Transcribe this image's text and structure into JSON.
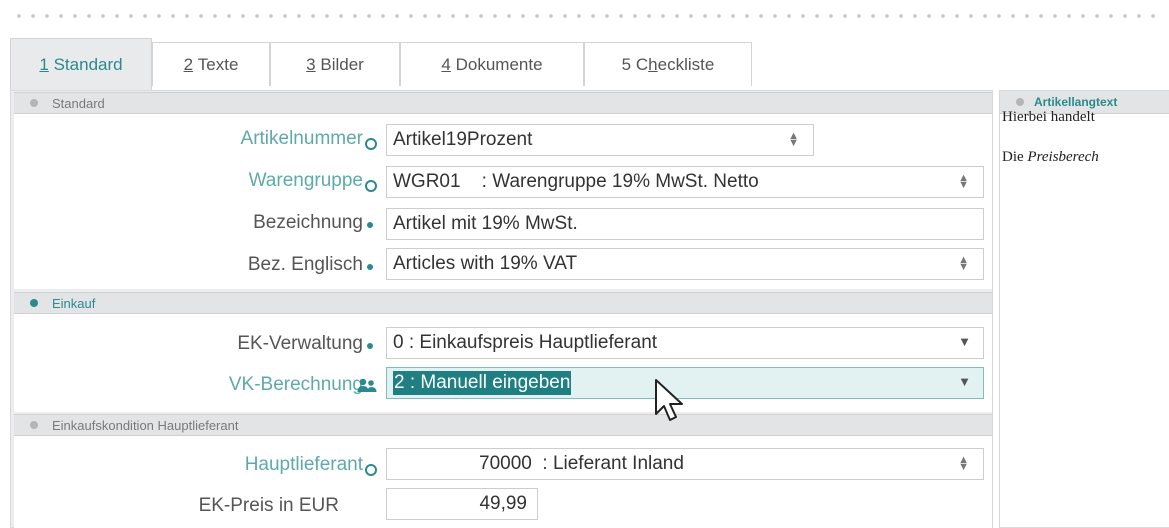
{
  "tabs": [
    {
      "key": "1",
      "label": "Standard",
      "active": true
    },
    {
      "key": "2",
      "label": "Texte"
    },
    {
      "key": "3",
      "label": "Bilder"
    },
    {
      "key": "4",
      "label": "Dokumente"
    },
    {
      "key": "5",
      "label": "Checkliste",
      "label_pre": "C",
      "label_key": "h",
      "label_post": "eckliste"
    }
  ],
  "sections": {
    "standard": {
      "title": "Standard",
      "artikelnummer": {
        "label": "Artikelnummer",
        "value": "Artikel19Prozent"
      },
      "warengruppe": {
        "label": "Warengruppe",
        "value": "WGR01    : Warengruppe 19% MwSt. Netto"
      },
      "bezeichnung": {
        "label": "Bezeichnung",
        "value": "Artikel mit 19% MwSt."
      },
      "bez_englisch": {
        "label": "Bez. Englisch",
        "value": "Articles with 19% VAT"
      }
    },
    "einkauf": {
      "title": "Einkauf",
      "ek_verwaltung": {
        "label": "EK-Verwaltung",
        "value": "0 : Einkaufspreis Hauptlieferant"
      },
      "vk_berechnung": {
        "label": "VK-Berechnung",
        "value": "2 : Manuell eingeben"
      }
    },
    "einkaufskondition": {
      "title": "Einkaufskondition Hauptlieferant",
      "hauptlieferant": {
        "label": "Hauptlieferant",
        "value": "70000  : Lieferant Inland"
      },
      "ek_preis": {
        "label": "EK-Preis in EUR",
        "value": "49,99"
      }
    }
  },
  "right_panel": {
    "title": "Artikellangtext",
    "line1": "Hierbei handelt",
    "line2_prefix": "Die ",
    "line2_italic": "Preisberech"
  },
  "colors": {
    "accent": "#2a8a8e",
    "label_teal": "#5ea9ab",
    "panel_bg": "#ecedee"
  },
  "icons": {
    "required": "bullet",
    "optional": "ring",
    "multi_user": "users-icon",
    "spinner": "updown-arrows",
    "dropdown": "caret-down"
  }
}
